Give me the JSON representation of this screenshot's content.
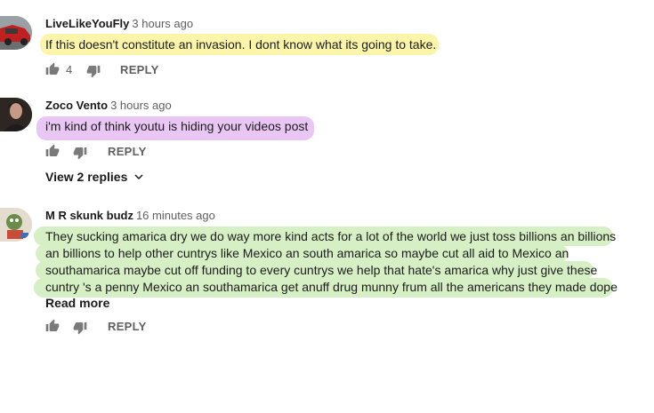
{
  "colors": {
    "highlight_yellow": "#fbf5a9",
    "highlight_purple": "#e9c6f3",
    "highlight_green": "#d6efc4",
    "secondary_text": "#606060",
    "icon": "#7a7a7a"
  },
  "comments": [
    {
      "author": "LiveLikeYouFly",
      "time": "3 hours ago",
      "text_lines": [
        "If this doesn't constitute an invasion. I dont know what its going to take."
      ],
      "like_count": "4",
      "reply_label": "REPLY",
      "avatar_icon": "red-car-avatar",
      "highlight": "yellow"
    },
    {
      "author": "Zoco Vento",
      "time": "3 hours ago",
      "text_lines": [
        "i'm kind of think youtu is hiding your videos post"
      ],
      "like_count": "",
      "reply_label": "REPLY",
      "view_replies_label": "View 2 replies",
      "avatar_icon": "person-avatar",
      "highlight": "purple"
    },
    {
      "author": "M R skunk budz",
      "time": "16 minutes ago",
      "text_lines": [
        "They sucking amarica dry we do way more kind acts for a lot of the world we just toss billions an billions",
        "an billions to help other cuntrys like Mexico an south amarica so maybe cut all aid to Mexico an",
        "southamarica maybe cut off funding to every cuntrys we help that hate's amarica why just give these",
        "cuntry 's a penny Mexico an southamarica get anuff drug munny frum all the americans they made dope"
      ],
      "read_more_label": "Read more",
      "like_count": "",
      "reply_label": "REPLY",
      "avatar_icon": "cartoon-avatar",
      "highlight": "green"
    }
  ]
}
